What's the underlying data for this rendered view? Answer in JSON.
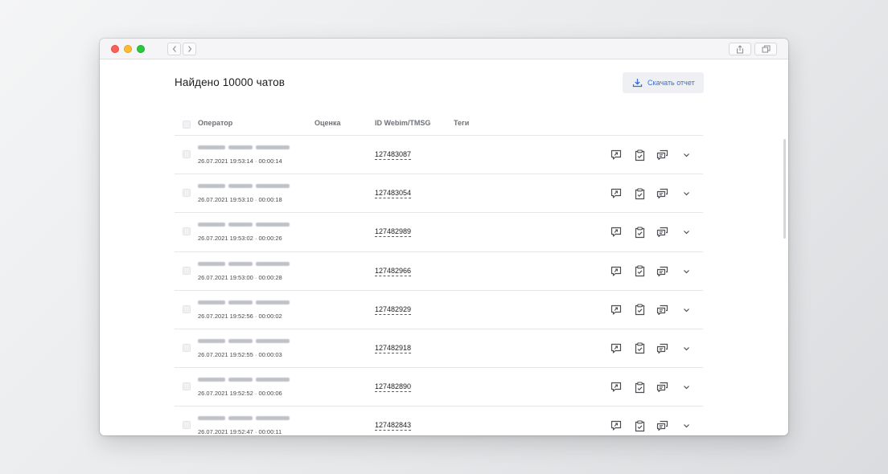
{
  "page": {
    "title": "Найдено 10000 чатов",
    "download_label": "Скачать отчет"
  },
  "table": {
    "columns": [
      "Оператор",
      "Оценка",
      "ID Webim/TMSG",
      "Теги"
    ],
    "rows": [
      {
        "datetime": "26.07.2021 19:53:14 · 00:00:14",
        "id": "127483087"
      },
      {
        "datetime": "26.07.2021 19:53:10 · 00:00:18",
        "id": "127483054"
      },
      {
        "datetime": "26.07.2021 19:53:02 · 00:00:26",
        "id": "127482989"
      },
      {
        "datetime": "26.07.2021 19:53:00 · 00:00:28",
        "id": "127482966"
      },
      {
        "datetime": "26.07.2021 19:52:56 · 00:00:02",
        "id": "127482929"
      },
      {
        "datetime": "26.07.2021 19:52:55 · 00:00:03",
        "id": "127482918"
      },
      {
        "datetime": "26.07.2021 19:52:52 · 00:00:06",
        "id": "127482890"
      },
      {
        "datetime": "26.07.2021 19:52:47 · 00:00:11",
        "id": "127482843"
      }
    ]
  },
  "row_actions": [
    "reply-icon",
    "clipboard-check-icon",
    "chat-bubbles-icon",
    "chevron-down-icon"
  ],
  "colors": {
    "accent": "#3a6fd0",
    "button_bg": "#eef0f3",
    "text": "#1c1d1f",
    "muted": "#6d7177"
  }
}
